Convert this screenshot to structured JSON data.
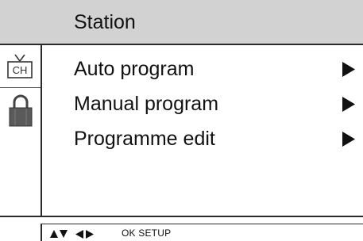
{
  "menu": {
    "title": "Station",
    "items": [
      {
        "label": "Auto program",
        "arrow_icon": "right-triangle-icon"
      },
      {
        "label": "Manual program",
        "arrow_icon": "right-triangle-icon"
      },
      {
        "label": "Programme edit",
        "arrow_icon": "right-triangle-icon"
      }
    ]
  },
  "sidebar": {
    "icons": [
      {
        "name": "tv-channel-icon",
        "text": "CH",
        "selected": true
      },
      {
        "name": "lock-icon",
        "selected": false
      }
    ]
  },
  "footer": {
    "key_icons": [
      "up-arrow-icon",
      "down-arrow-icon",
      "left-arrow-icon",
      "right-arrow-icon"
    ],
    "hint": "OK SETUP"
  },
  "colors": {
    "title_bar": "#d2d2d2",
    "text": "#111111",
    "border": "#2a2a2a"
  }
}
